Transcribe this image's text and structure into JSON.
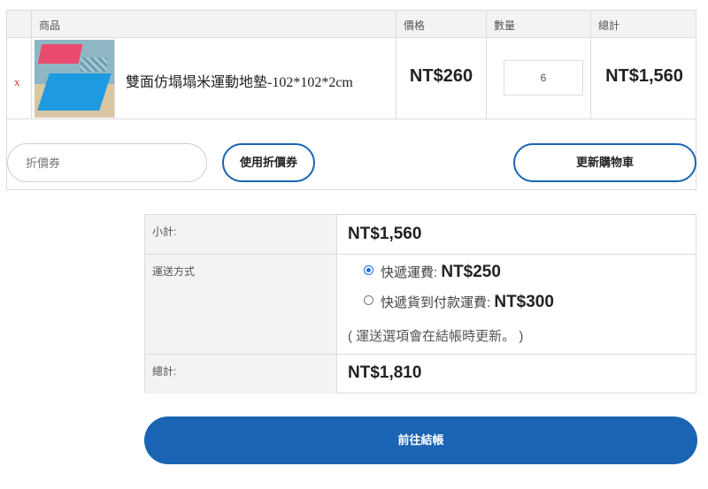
{
  "cart": {
    "headers": {
      "product": "商品",
      "price": "價格",
      "quantity": "數量",
      "total": "總計"
    },
    "item": {
      "remove": "x",
      "name": "雙面仿塌塌米運動地墊-102*102*2cm",
      "price": "NT$260",
      "quantity": "6",
      "total": "NT$1,560"
    },
    "coupon_placeholder": "折價券",
    "apply_coupon_label": "使用折價券",
    "update_cart_label": "更新購物車"
  },
  "totals": {
    "subtotal_label": "小計:",
    "subtotal": "NT$1,560",
    "shipping_label": "運送方式",
    "shipping_options": [
      {
        "label": "快遞運費:",
        "price": "NT$250",
        "selected": true
      },
      {
        "label": "快遞貨到付款運費:",
        "price": "NT$300",
        "selected": false
      }
    ],
    "shipping_note": "( 運送選項會在結帳時更新。 )",
    "total_label": "總計:",
    "total": "NT$1,810"
  },
  "checkout_label": "前往結帳",
  "colors": {
    "accent": "#1a64b3",
    "remove": "#c0392b",
    "radio": "#1a73e8"
  }
}
